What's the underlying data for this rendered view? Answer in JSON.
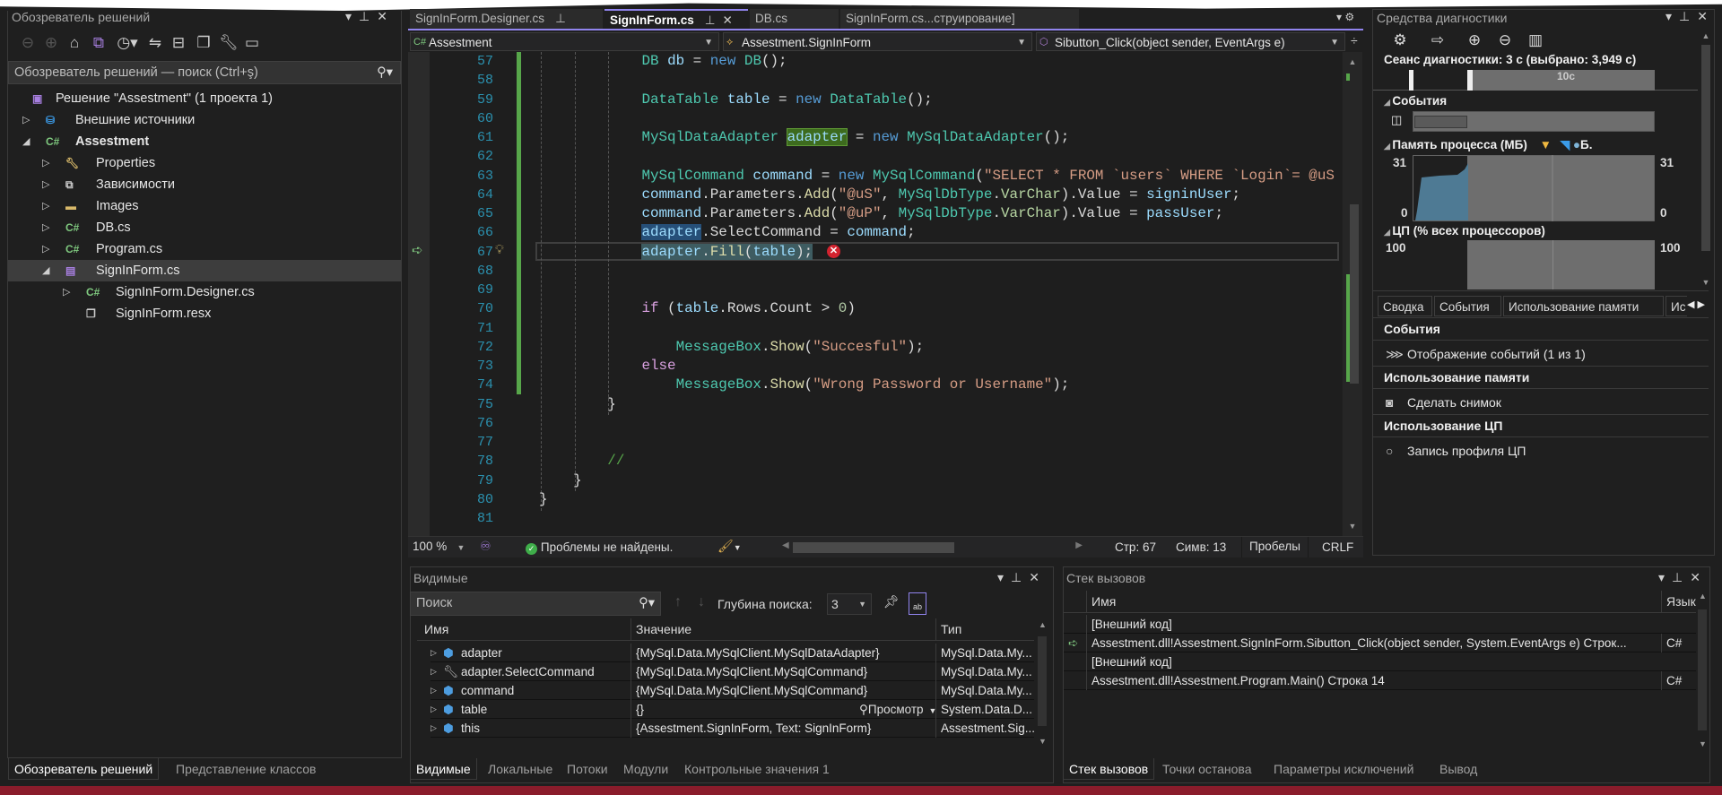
{
  "solution_explorer": {
    "title": "Обозреватель решений",
    "search_placeholder": "Обозреватель решений — поиск (Ctrl+ş)",
    "tree": [
      {
        "label": "Решение \"Assestment\"  (1 проекта 1)",
        "icon": "solution-icon",
        "level": 0,
        "arrow": ""
      },
      {
        "label": "Внешние источники",
        "icon": "external-sources-icon",
        "level": 1,
        "arrow": "▷"
      },
      {
        "label": "Assestment",
        "icon": "csharp-project-icon",
        "level": 1,
        "arrow": "◢",
        "bold": true
      },
      {
        "label": "Properties",
        "icon": "properties-folder-icon",
        "level": 2,
        "arrow": "▷"
      },
      {
        "label": "Зависимости",
        "icon": "dependencies-icon",
        "level": 2,
        "arrow": "▷"
      },
      {
        "label": "Images",
        "icon": "folder-icon",
        "level": 2,
        "arrow": "▷"
      },
      {
        "label": "DB.cs",
        "icon": "csharp-file-icon",
        "level": 2,
        "arrow": "▷"
      },
      {
        "label": "Program.cs",
        "icon": "csharp-file-icon",
        "level": 2,
        "arrow": "▷"
      },
      {
        "label": "SignInForm.cs",
        "icon": "form-file-icon",
        "level": 2,
        "arrow": "◢",
        "selected": true
      },
      {
        "label": "SignInForm.Designer.cs",
        "icon": "csharp-file-icon",
        "level": 3,
        "arrow": "▷"
      },
      {
        "label": "SignInForm.resx",
        "icon": "resx-file-icon",
        "level": 3,
        "arrow": ""
      }
    ],
    "bottom_tabs": [
      "Обозреватель решений",
      "Представление классов"
    ]
  },
  "editor": {
    "tabs": [
      {
        "label": "SignInForm.Designer.cs",
        "pinned": true
      },
      {
        "label": "SignInForm.cs",
        "active": true
      },
      {
        "label": "DB.cs"
      },
      {
        "label": "SignInForm.cs...струирование]"
      }
    ],
    "nav": {
      "project": "Assestment",
      "class": "Assestment.SignInForm",
      "member": "Sibutton_Click(object sender, EventArgs e)"
    },
    "lines": [
      {
        "n": 57,
        "t": [
          [
            "            ",
            "p"
          ],
          [
            "DB",
            "ty"
          ],
          [
            " ",
            "p"
          ],
          [
            "db",
            "var"
          ],
          [
            " = ",
            "p"
          ],
          [
            "new",
            "kw"
          ],
          [
            " ",
            "p"
          ],
          [
            "DB",
            "ty"
          ],
          [
            "();",
            "p"
          ]
        ]
      },
      {
        "n": 58,
        "t": []
      },
      {
        "n": 59,
        "t": [
          [
            "            ",
            "p"
          ],
          [
            "DataTable",
            "ty"
          ],
          [
            " ",
            "p"
          ],
          [
            "table",
            "var"
          ],
          [
            " = ",
            "p"
          ],
          [
            "new",
            "kw"
          ],
          [
            " ",
            "p"
          ],
          [
            "DataTable",
            "ty"
          ],
          [
            "();",
            "p"
          ]
        ]
      },
      {
        "n": 60,
        "t": []
      },
      {
        "n": 61,
        "t": [
          [
            "            ",
            "p"
          ],
          [
            "MySqlDataAdapter",
            "ty"
          ],
          [
            " ",
            "p"
          ],
          [
            "adapter",
            "var hl-green"
          ],
          [
            " = ",
            "p"
          ],
          [
            "new",
            "kw"
          ],
          [
            " ",
            "p"
          ],
          [
            "MySqlDataAdapter",
            "ty"
          ],
          [
            "();",
            "p"
          ]
        ]
      },
      {
        "n": 62,
        "t": []
      },
      {
        "n": 63,
        "t": [
          [
            "            ",
            "p"
          ],
          [
            "MySqlCommand",
            "ty"
          ],
          [
            " ",
            "p"
          ],
          [
            "command",
            "var"
          ],
          [
            " = ",
            "p"
          ],
          [
            "new",
            "kw"
          ],
          [
            " ",
            "p"
          ],
          [
            "MySqlCommand",
            "ty"
          ],
          [
            "(",
            "p"
          ],
          [
            "\"SELECT * FROM `users` WHERE `Login`= @uS A",
            "str"
          ]
        ]
      },
      {
        "n": 64,
        "t": [
          [
            "            ",
            "p"
          ],
          [
            "command",
            "var"
          ],
          [
            ".Parameters.",
            "p"
          ],
          [
            "Add",
            "mth"
          ],
          [
            "(",
            "p"
          ],
          [
            "\"@uS\"",
            "str"
          ],
          [
            ", ",
            "p"
          ],
          [
            "MySqlDbType",
            "ty"
          ],
          [
            ".",
            "p"
          ],
          [
            "VarChar",
            "enum"
          ],
          [
            ").Value = ",
            "p"
          ],
          [
            "signinUser",
            "var"
          ],
          [
            ";",
            "p"
          ]
        ]
      },
      {
        "n": 65,
        "t": [
          [
            "            ",
            "p"
          ],
          [
            "command",
            "var"
          ],
          [
            ".Parameters.",
            "p"
          ],
          [
            "Add",
            "mth"
          ],
          [
            "(",
            "p"
          ],
          [
            "\"@uP\"",
            "str"
          ],
          [
            ", ",
            "p"
          ],
          [
            "MySqlDbType",
            "ty"
          ],
          [
            ".",
            "p"
          ],
          [
            "VarChar",
            "enum"
          ],
          [
            ").Value = ",
            "p"
          ],
          [
            "passUser",
            "var"
          ],
          [
            ";",
            "p"
          ]
        ]
      },
      {
        "n": 66,
        "t": [
          [
            "            ",
            "p"
          ],
          [
            "adapter",
            "var hl-sel"
          ],
          [
            ".SelectCommand = ",
            "p"
          ],
          [
            "command",
            "var"
          ],
          [
            ";",
            "p"
          ]
        ]
      },
      {
        "n": 67,
        "t": [
          [
            "            ",
            "p"
          ],
          [
            "adapter",
            "var hl-cur"
          ],
          [
            ".",
            "p hl-cur"
          ],
          [
            "Fill",
            "mth hl-cur"
          ],
          [
            "(",
            "p hl-cur"
          ],
          [
            "table",
            "var hl-cur"
          ],
          [
            ");",
            "p hl-cur"
          ]
        ],
        "current": true
      },
      {
        "n": 68,
        "t": []
      },
      {
        "n": 69,
        "t": []
      },
      {
        "n": 70,
        "t": [
          [
            "            ",
            "p"
          ],
          [
            "if",
            "ctl"
          ],
          [
            " (",
            "p"
          ],
          [
            "table",
            "var"
          ],
          [
            ".Rows.Count > ",
            "p"
          ],
          [
            "0",
            "num"
          ],
          [
            ")",
            "p"
          ]
        ]
      },
      {
        "n": 71,
        "t": []
      },
      {
        "n": 72,
        "t": [
          [
            "                ",
            "p"
          ],
          [
            "MessageBox",
            "ty"
          ],
          [
            ".",
            "p"
          ],
          [
            "Show",
            "mth"
          ],
          [
            "(",
            "p"
          ],
          [
            "\"Succesful\"",
            "str"
          ],
          [
            ");",
            "p"
          ]
        ]
      },
      {
        "n": 73,
        "t": [
          [
            "            ",
            "p"
          ],
          [
            "else",
            "ctl"
          ]
        ]
      },
      {
        "n": 74,
        "t": [
          [
            "                ",
            "p"
          ],
          [
            "MessageBox",
            "ty"
          ],
          [
            ".",
            "p"
          ],
          [
            "Show",
            "mth"
          ],
          [
            "(",
            "p"
          ],
          [
            "\"Wrong Password or Username\"",
            "str"
          ],
          [
            ");",
            "p"
          ]
        ]
      },
      {
        "n": 75,
        "t": [
          [
            "        ",
            "p"
          ],
          [
            "}",
            "p"
          ]
        ]
      },
      {
        "n": 76,
        "t": []
      },
      {
        "n": 77,
        "t": []
      },
      {
        "n": 78,
        "t": [
          [
            "        ",
            "p"
          ],
          [
            "//",
            "cm"
          ]
        ]
      },
      {
        "n": 79,
        "t": [
          [
            "    ",
            "p"
          ],
          [
            "}",
            "p"
          ]
        ]
      },
      {
        "n": 80,
        "t": [
          [
            "}",
            "p"
          ]
        ]
      },
      {
        "n": 81,
        "t": []
      }
    ],
    "status": {
      "zoom": "100 %",
      "problems": "Проблемы не найдены.",
      "line": "Стр: 67",
      "col": "Симв: 13",
      "whitespace": "Пробелы",
      "eol": "CRLF"
    }
  },
  "diagnostics": {
    "title": "Средства диагностики",
    "session": "Сеанс диагностики: 3 с (выбрано: 3,949 с)",
    "ruler_label": "10с",
    "events_header": "События",
    "memory_header": "Память процесса (МБ)",
    "memory_legend": "Б.",
    "memory_max": "31",
    "memory_min": "0",
    "cpu_header": "ЦП (% всех процессоров)",
    "cpu_max": "100",
    "tabs": [
      "Сводка",
      "События",
      "Использование памяти",
      "Ис"
    ],
    "sections": [
      {
        "title": "События",
        "action": "Отображение событий (1 из 1)",
        "icon": "events-icon"
      },
      {
        "title": "Использование памяти",
        "action": "Сделать снимок",
        "icon": "camera-icon"
      },
      {
        "title": "Использование ЦП",
        "action": "Запись профиля ЦП",
        "icon": "record-icon"
      }
    ]
  },
  "watch": {
    "title": "Видимые",
    "search_placeholder": "Поиск",
    "depth_label": "Глубина поиска:",
    "depth_value": "3",
    "columns": [
      "Имя",
      "Значение",
      "Тип"
    ],
    "rows": [
      {
        "name": "adapter",
        "value": "{MySql.Data.MySqlClient.MySqlDataAdapter}",
        "type": "MySql.Data.My...",
        "icon": "object-icon"
      },
      {
        "name": "adapter.SelectCommand",
        "value": "{MySql.Data.MySqlClient.MySqlCommand}",
        "type": "MySql.Data.My...",
        "icon": "property-wrench-icon"
      },
      {
        "name": "command",
        "value": "{MySql.Data.MySqlClient.MySqlCommand}",
        "type": "MySql.Data.My...",
        "icon": "object-icon"
      },
      {
        "name": "table",
        "value": "{}",
        "type": "System.Data.D...",
        "icon": "object-icon",
        "viewer": "Просмотр"
      },
      {
        "name": "this",
        "value": "{Assestment.SignInForm, Text: SignInForm}",
        "type": "Assestment.Sig...",
        "icon": "object-icon"
      }
    ],
    "bottom_tabs": [
      "Видимые",
      "Локальные",
      "Потоки",
      "Модули",
      "Контрольные значения 1"
    ]
  },
  "callstack": {
    "title": "Стек вызовов",
    "columns": [
      "Имя",
      "Язык"
    ],
    "rows": [
      {
        "name": "[Внешний код]",
        "lang": ""
      },
      {
        "name": "Assestment.dll!Assestment.SignInForm.Sibutton_Click(object sender, System.EventArgs e) Строк...",
        "lang": "C#",
        "current": true
      },
      {
        "name": "[Внешний код]",
        "lang": ""
      },
      {
        "name": "Assestment.dll!Assestment.Program.Main() Строка 14",
        "lang": "C#"
      }
    ],
    "bottom_tabs": [
      "Стек вызовов",
      "Точки останова",
      "Параметры исключений",
      "Вывод"
    ]
  }
}
